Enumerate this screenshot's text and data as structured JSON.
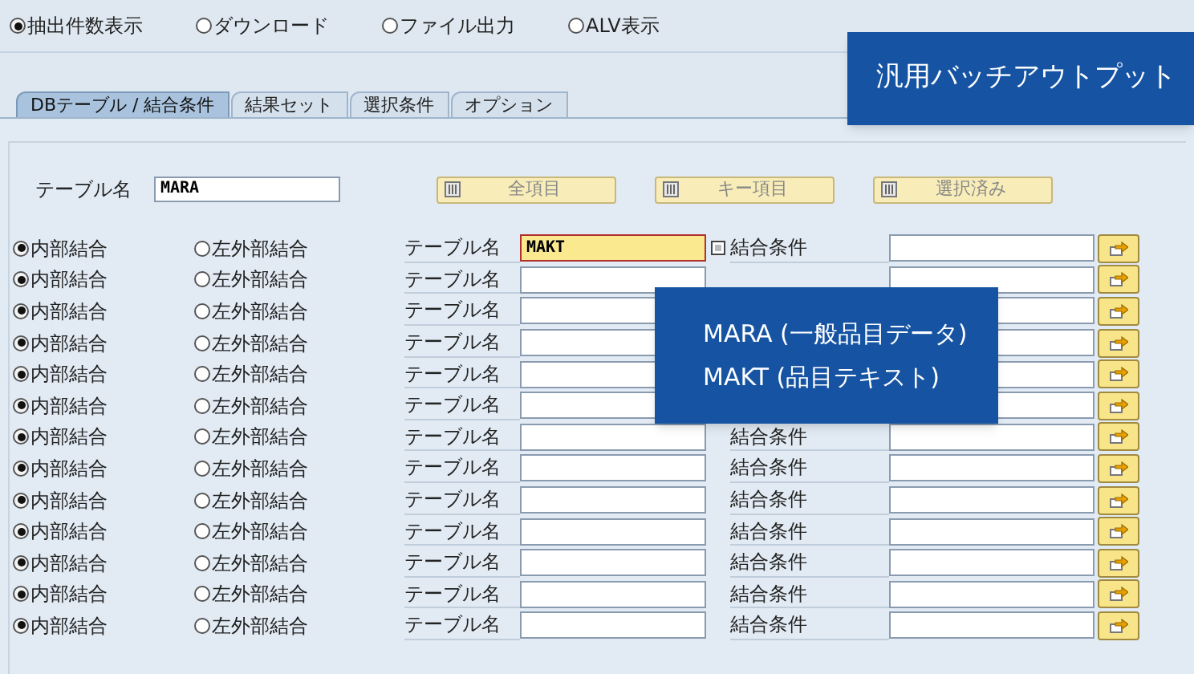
{
  "output_options": [
    {
      "label": "抽出件数表示",
      "selected": true
    },
    {
      "label": "ダウンロード",
      "selected": false
    },
    {
      "label": "ファイル出力",
      "selected": false
    },
    {
      "label": "ALV表示",
      "selected": false
    }
  ],
  "title_banner": "汎用バッチアウトプット",
  "tabs": [
    {
      "label": "DBテーブル / 結合条件",
      "selected": true
    },
    {
      "label": "結果セット",
      "selected": false
    },
    {
      "label": "選択条件",
      "selected": false
    },
    {
      "label": "オプション",
      "selected": false
    }
  ],
  "main_table": {
    "label": "テーブル名",
    "value": "MARA"
  },
  "field_buttons": [
    "全項目",
    "キー項目",
    "選択済み"
  ],
  "join_rows": [
    {
      "inner": "内部結合",
      "inner_selected": true,
      "outer": "左外部結合",
      "outer_selected": false,
      "table_label": "テーブル名",
      "table_value": "MAKT",
      "focused": true,
      "condition_label": "結合条件"
    },
    {
      "inner": "内部結合",
      "inner_selected": true,
      "outer": "左外部結合",
      "outer_selected": false,
      "table_label": "テーブル名",
      "focused": false
    },
    {
      "inner": "内部結合",
      "inner_selected": true,
      "outer": "左外部結合",
      "outer_selected": false,
      "table_label": "テーブル名",
      "focused": false
    },
    {
      "inner": "内部結合",
      "inner_selected": true,
      "outer": "左外部結合",
      "outer_selected": false,
      "table_label": "テーブル名",
      "focused": false
    },
    {
      "inner": "内部結合",
      "inner_selected": true,
      "outer": "左外部結合",
      "outer_selected": false,
      "table_label": "テーブル名",
      "focused": false
    },
    {
      "inner": "内部結合",
      "inner_selected": true,
      "outer": "左外部結合",
      "outer_selected": false,
      "table_label": "テーブル名",
      "focused": false
    },
    {
      "inner": "内部結合",
      "inner_selected": true,
      "outer": "左外部結合",
      "outer_selected": false,
      "table_label": "テーブル名",
      "focused": false,
      "condition_label": "結合条件"
    },
    {
      "inner": "内部結合",
      "inner_selected": true,
      "outer": "左外部結合",
      "outer_selected": false,
      "table_label": "テーブル名",
      "focused": false,
      "condition_label": "結合条件"
    },
    {
      "inner": "内部結合",
      "inner_selected": true,
      "outer": "左外部結合",
      "outer_selected": false,
      "table_label": "テーブル名",
      "focused": false,
      "condition_label": "結合条件"
    },
    {
      "inner": "内部結合",
      "inner_selected": true,
      "outer": "左外部結合",
      "outer_selected": false,
      "table_label": "テーブル名",
      "focused": false,
      "condition_label": "結合条件"
    },
    {
      "inner": "内部結合",
      "inner_selected": true,
      "outer": "左外部結合",
      "outer_selected": false,
      "table_label": "テーブル名",
      "focused": false,
      "condition_label": "結合条件"
    },
    {
      "inner": "内部結合",
      "inner_selected": true,
      "outer": "左外部結合",
      "outer_selected": false,
      "table_label": "テーブル名",
      "focused": false,
      "condition_label": "結合条件"
    },
    {
      "inner": "内部結合",
      "inner_selected": true,
      "outer": "左外部結合",
      "outer_selected": false,
      "table_label": "テーブル名",
      "focused": false,
      "condition_label": "結合条件"
    }
  ],
  "caption": [
    "MARA (一般品目データ)",
    "MAKT (品目テキスト)"
  ]
}
